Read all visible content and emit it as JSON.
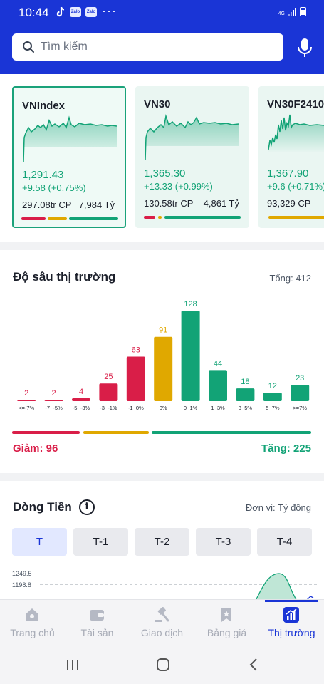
{
  "status_bar": {
    "time": "10:44",
    "network": "4G",
    "notif_apps": [
      "Zalo",
      "Zalo"
    ],
    "more": "···"
  },
  "search": {
    "placeholder": "Tìm kiếm"
  },
  "indices": [
    {
      "name": "VNIndex",
      "price": "1,291.43",
      "change": "+9.58 (+0.75%)",
      "volume": "297.08tr CP",
      "value": "7,984 Tỷ"
    },
    {
      "name": "VN30",
      "price": "1,365.30",
      "change": "+13.33 (+0.99%)",
      "volume": "130.58tr CP",
      "value": "4,861 Tỷ"
    },
    {
      "name": "VN30F2410",
      "price": "1,367.90",
      "change": "+9.6 (+0.71%)",
      "volume": "93,329 CP",
      "value": ""
    }
  ],
  "market_depth": {
    "title": "Độ sâu thị trường",
    "total": "Tổng: 412",
    "down_label": "Giảm: 96",
    "up_label": "Tăng: 225"
  },
  "chart_data": {
    "type": "bar",
    "title": "Độ sâu thị trường",
    "categories": [
      "<=-7%",
      "-7~-5%",
      "-5~-3%",
      "-3~-1%",
      "-1~0%",
      "0%",
      "0~1%",
      "1~3%",
      "3~5%",
      "5~7%",
      ">=7%"
    ],
    "values": [
      2,
      2,
      4,
      25,
      63,
      91,
      128,
      44,
      18,
      12,
      23
    ],
    "colors": [
      "#d91e48",
      "#d91e48",
      "#d91e48",
      "#d91e48",
      "#d91e48",
      "#e0a800",
      "#12a376",
      "#12a376",
      "#12a376",
      "#12a376",
      "#12a376"
    ]
  },
  "money_flow": {
    "title": "Dòng Tiền",
    "unit": "Đơn vị: Tỷ đồng",
    "tabs": [
      "T",
      "T-1",
      "T-2",
      "T-3",
      "T-4"
    ],
    "active_tab": "T",
    "y_ticks": [
      "1249.5",
      "1198.8"
    ]
  },
  "bottom_nav": [
    {
      "label": "Trang chủ",
      "icon": "home-icon"
    },
    {
      "label": "Tài sản",
      "icon": "wallet-icon"
    },
    {
      "label": "Giao dịch",
      "icon": "gavel-icon"
    },
    {
      "label": "Bảng giá",
      "icon": "bookmark-icon"
    },
    {
      "label": "Thị trường",
      "icon": "market-chart-icon"
    }
  ],
  "colors": {
    "brand": "#1a35d6",
    "up": "#12a376",
    "down": "#d91e48",
    "ref": "#e0a800"
  }
}
